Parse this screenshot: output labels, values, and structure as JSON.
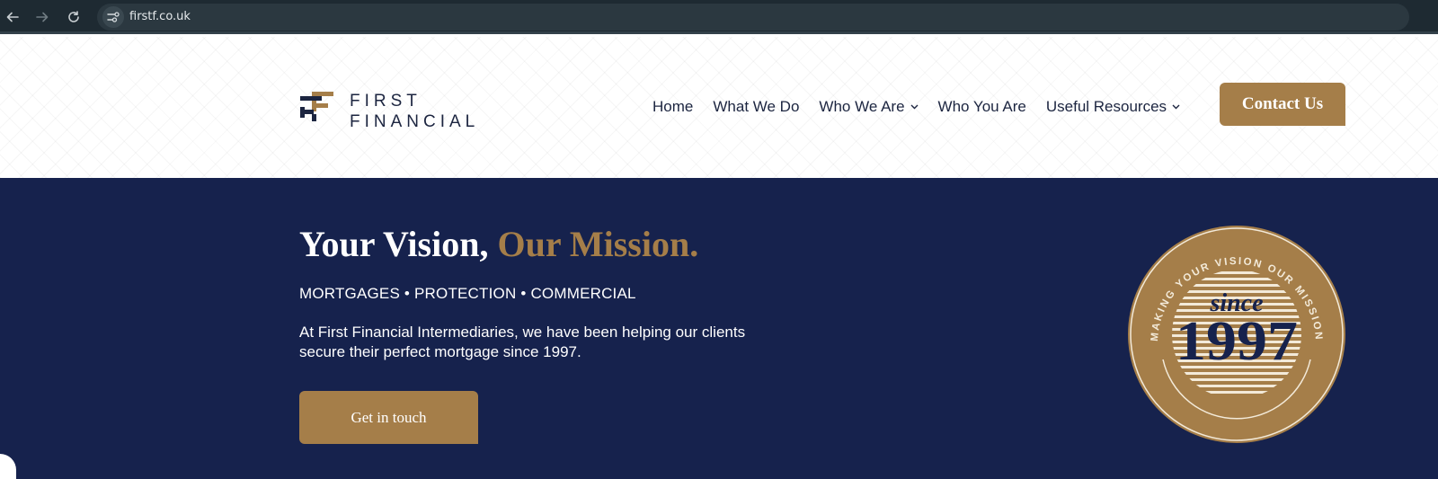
{
  "browser": {
    "url": "firstf.co.uk",
    "icons": [
      "back-arrow-icon",
      "forward-arrow-icon",
      "reload-icon",
      "site-settings-icon"
    ]
  },
  "header": {
    "logo": {
      "line1": "FIRST",
      "line2": "FINANCIAL"
    },
    "nav": [
      {
        "label": "Home",
        "has_dropdown": false
      },
      {
        "label": "What We Do",
        "has_dropdown": false
      },
      {
        "label": "Who We Are",
        "has_dropdown": true
      },
      {
        "label": "Who You Are",
        "has_dropdown": false
      },
      {
        "label": "Useful Resources",
        "has_dropdown": true
      }
    ],
    "contact_label": "Contact Us"
  },
  "hero": {
    "title_main": "Your Vision,",
    "title_accent": "Our Mission.",
    "services": "MORTGAGES • PROTECTION • COMMERCIAL",
    "description": "At First Financial Intermediaries, we have been helping our clients secure their perfect mortgage since 1997.",
    "cta_label": "Get in touch",
    "badge": {
      "ring_text": "MAKING YOUR VISION OUR MISSION",
      "since": "since",
      "year": "1997"
    }
  },
  "colors": {
    "navy": "#16224d",
    "gold": "#a57e49",
    "chrome": "#1e2a32",
    "text_dark": "#1c2540"
  }
}
